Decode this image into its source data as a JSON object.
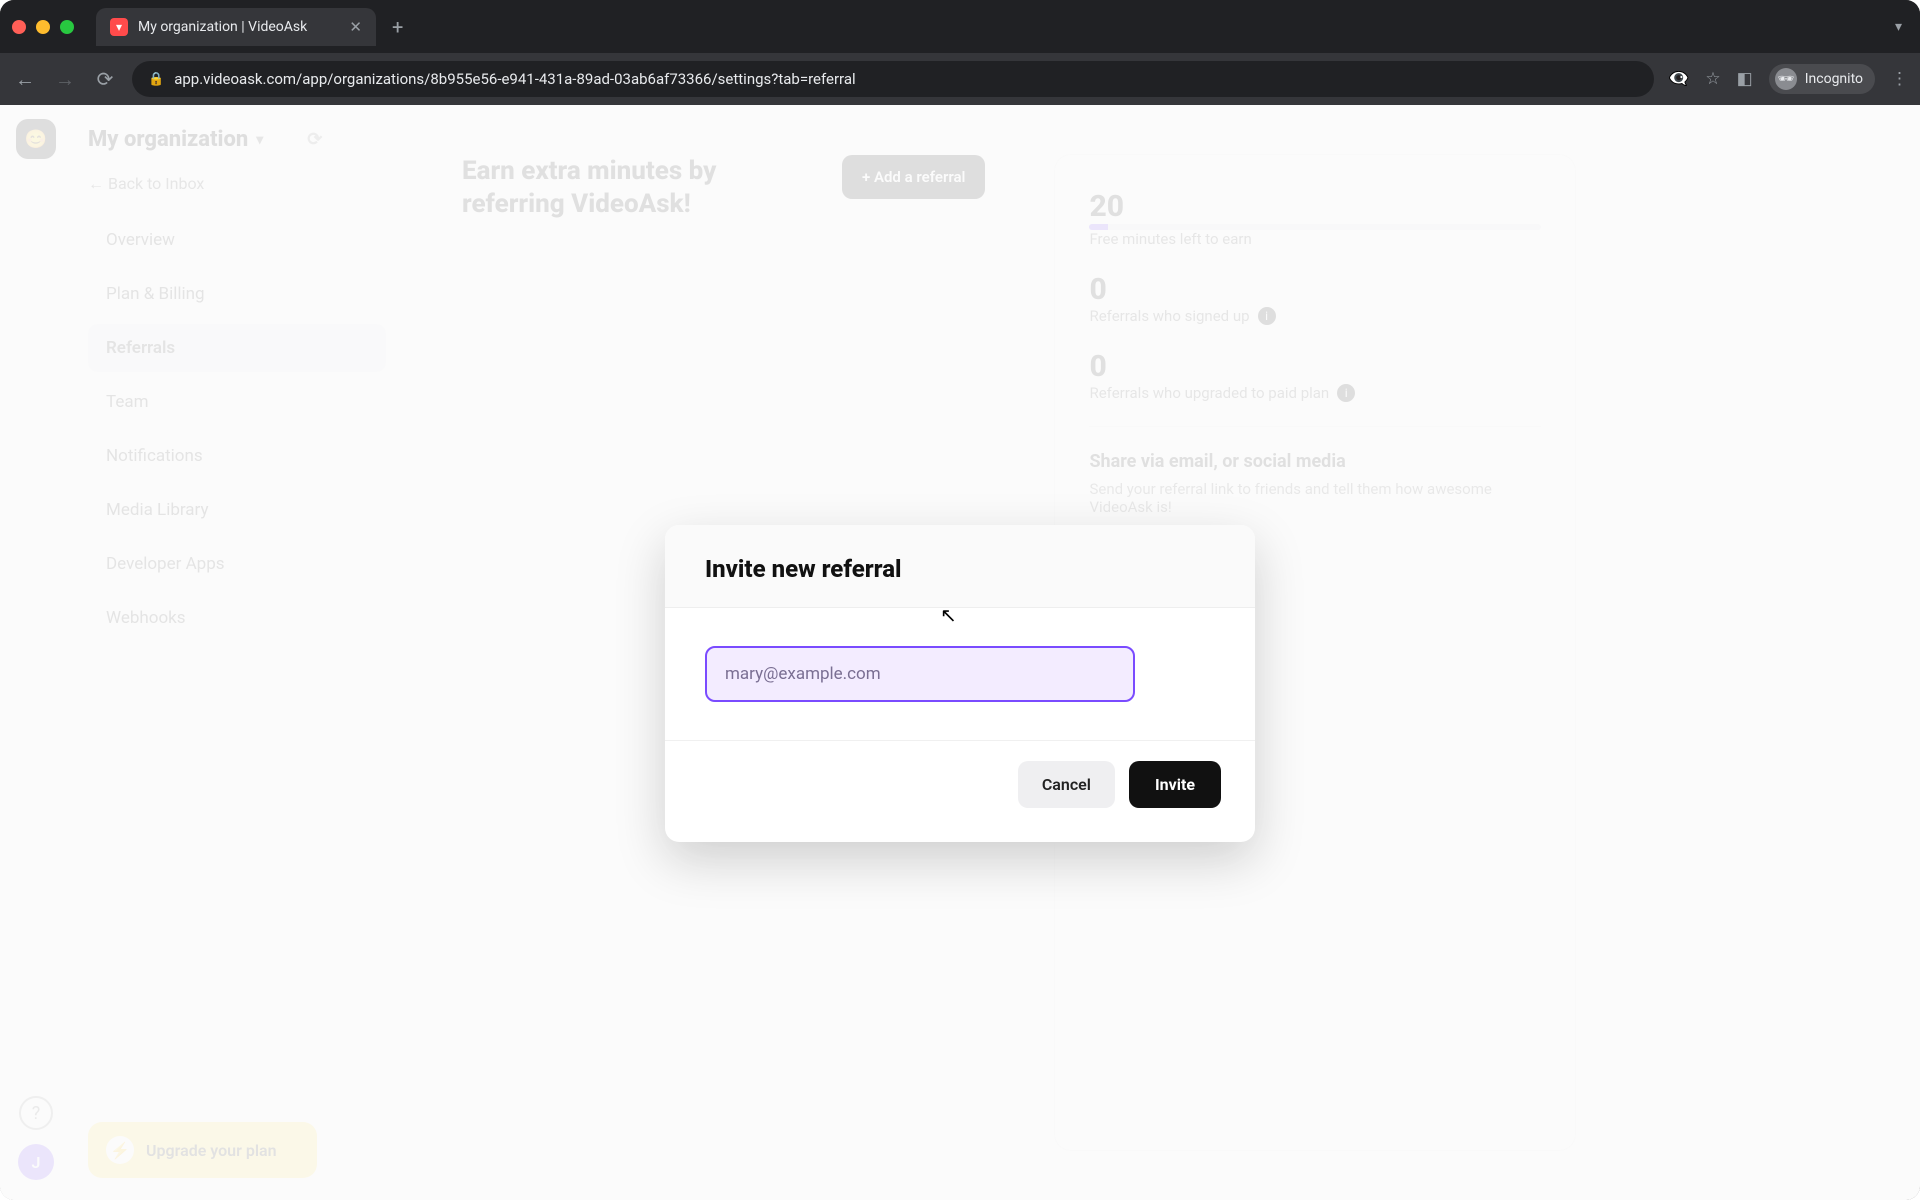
{
  "browser": {
    "tab_title": "My organization | VideoAsk",
    "url": "app.videoask.com/app/organizations/8b955e56-e941-431a-89ad-03ab6af73366/settings?tab=referral",
    "incognito_label": "Incognito"
  },
  "sidebar": {
    "org_name": "My organization",
    "back_label": "← Back to Inbox",
    "items": [
      {
        "label": "Overview"
      },
      {
        "label": "Plan & Billing"
      },
      {
        "label": "Referrals"
      },
      {
        "label": "Team"
      },
      {
        "label": "Notifications"
      },
      {
        "label": "Media Library"
      },
      {
        "label": "Developer Apps"
      },
      {
        "label": "Webhooks"
      }
    ],
    "active_index": 2,
    "upgrade_label": "Upgrade your plan"
  },
  "main": {
    "heading": "Earn extra minutes by referring VideoAsk!",
    "add_button": "+ Add a referral",
    "stats": {
      "minutes_value": "20",
      "minutes_label": "Free minutes left to earn",
      "signups_value": "0",
      "signups_label": "Referrals who signed up",
      "paid_value": "0",
      "paid_label": "Referrals who upgraded to paid plan"
    },
    "share": {
      "title": "Share via email, or social media",
      "desc": "Send your referral link to friends and tell them how awesome VideoAsk is!"
    }
  },
  "modal": {
    "title": "Invite new referral",
    "email_placeholder": "mary@example.com",
    "email_value": "",
    "cancel_label": "Cancel",
    "invite_label": "Invite"
  }
}
